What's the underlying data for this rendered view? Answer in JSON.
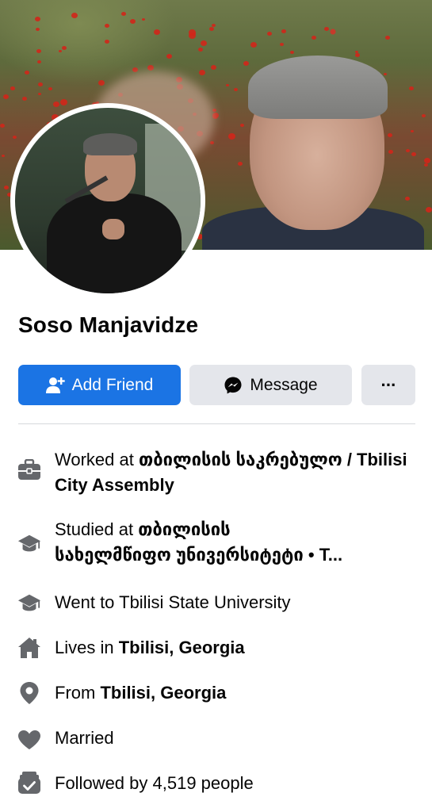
{
  "profile": {
    "name": "Soso Manjavidze"
  },
  "actions": {
    "add_friend_label": "Add Friend",
    "message_label": "Message",
    "more_label": "···"
  },
  "details": {
    "work_prefix": "Worked at ",
    "work_place": "თბილისის საკრებულო / Tbilisi City Assembly",
    "study_prefix": "Studied at ",
    "study_line1": "თბილისის",
    "study_line2": "სახელმწიფო უნივერსიტეტი • T...",
    "went_to": "Went to Tbilisi State University",
    "lives_prefix": "Lives in ",
    "lives_place": "Tbilisi, Georgia",
    "from_prefix": "From ",
    "from_place": "Tbilisi, Georgia",
    "relationship": "Married",
    "followers": "Followed by 4,519 people"
  },
  "icons": {
    "work": "briefcase-icon",
    "study": "graduation-cap-icon",
    "school": "graduation-cap-icon",
    "home": "house-icon",
    "from": "location-pin-icon",
    "relationship": "heart-icon",
    "followers": "followers-check-icon"
  },
  "colors": {
    "primary": "#1b74e4",
    "secondary_button": "#e4e6eb",
    "icon_gray": "#65676b",
    "text": "#050505"
  }
}
